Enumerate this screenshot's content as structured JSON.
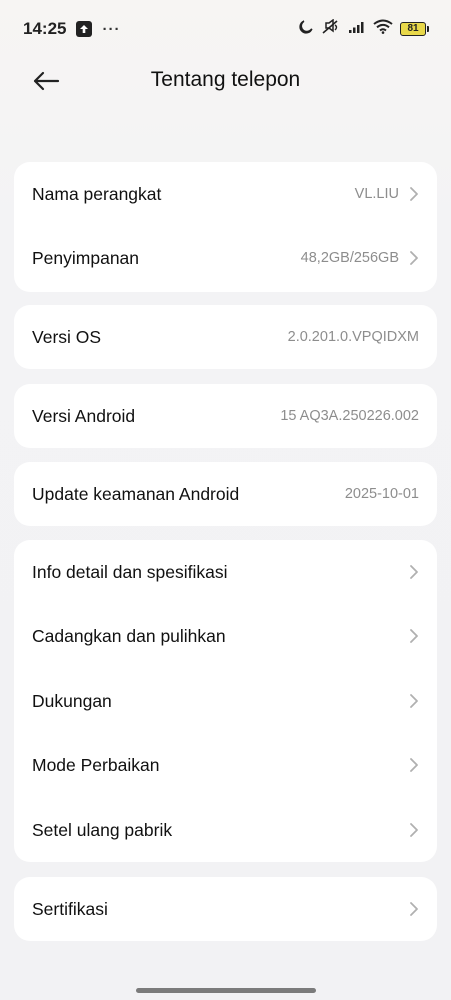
{
  "status_bar": {
    "time": "14:25",
    "more": "···",
    "battery": "81"
  },
  "header": {
    "title": "Tentang telepon"
  },
  "card1": {
    "rows": [
      {
        "label": "Nama perangkat",
        "value": "VL.LIU"
      },
      {
        "label": "Penyimpanan",
        "value": "48,2GB/256GB"
      }
    ]
  },
  "card_os": {
    "label": "Versi OS",
    "value": "2.0.201.0.VPQIDXM"
  },
  "card_android": {
    "label": "Versi Android",
    "value": "15 AQ3A.250226.002"
  },
  "card_security": {
    "label": "Update keamanan Android",
    "value": "2025-10-01"
  },
  "card_menu": {
    "rows": [
      {
        "label": "Info detail dan spesifikasi"
      },
      {
        "label": "Cadangkan dan pulihkan"
      },
      {
        "label": "Dukungan"
      },
      {
        "label": "Mode Perbaikan"
      },
      {
        "label": "Setel ulang pabrik"
      }
    ]
  },
  "card_cert": {
    "label": "Sertifikasi"
  },
  "colors": {
    "background": "#f2f2f4",
    "card": "#ffffff",
    "secondary_text": "#8d8d8d",
    "battery_fill": "#e8d84a"
  }
}
